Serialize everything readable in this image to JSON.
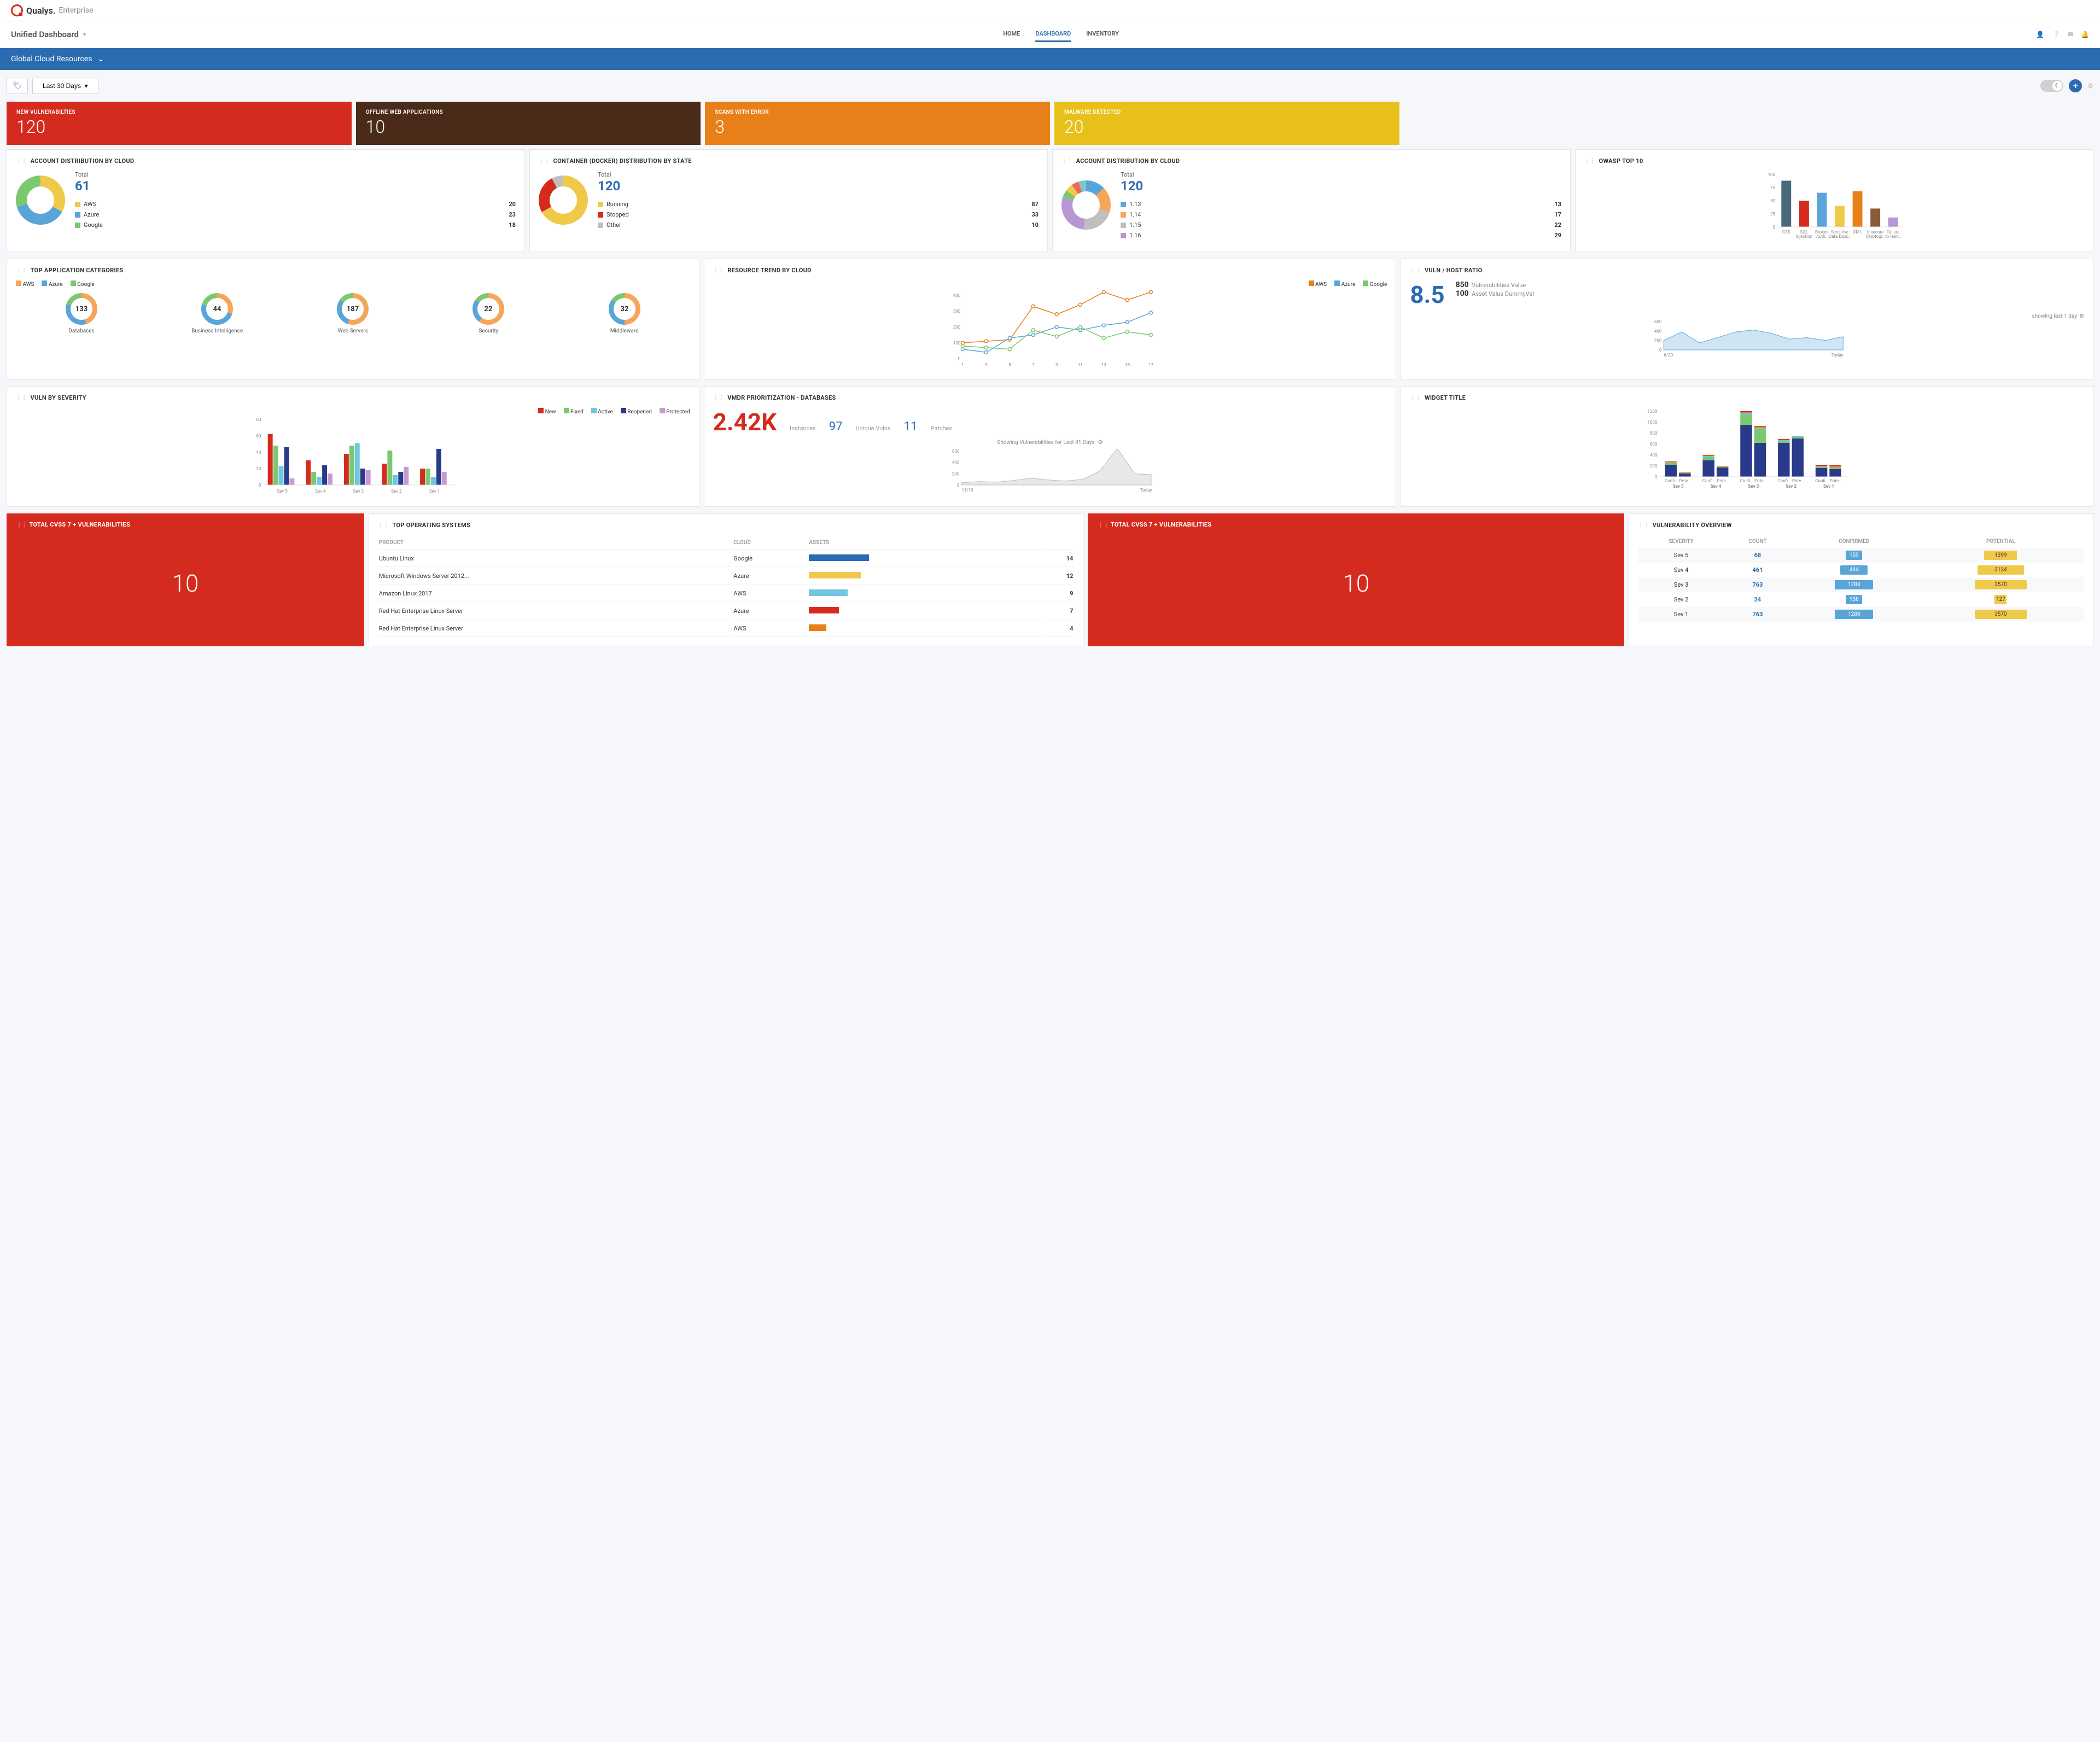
{
  "brand": {
    "name": "Qualys.",
    "suffix": "Enterprise"
  },
  "dashboard_title": "Unified Dashboard",
  "nav": {
    "items": [
      "HOME",
      "DASHBOARD",
      "INVENTORY"
    ],
    "active": 1
  },
  "blue_bar": "Global Cloud Resources",
  "date_range": "Last 30 Days",
  "stats": [
    {
      "label": "NEW VULNERABILTIES",
      "value": "120",
      "class": "stat-red"
    },
    {
      "label": "OFFLINE WEB APPLICATIONS",
      "value": "10",
      "class": "stat-brown"
    },
    {
      "label": "SCANS WITH ERROR",
      "value": "3",
      "class": "stat-orange"
    },
    {
      "label": "MALWARE DETECTED",
      "value": "20",
      "class": "stat-yellow"
    }
  ],
  "donut1": {
    "title": "ACCOUNT DISTRIBUTION BY CLOUD",
    "total_label": "Total",
    "total": "61",
    "items": [
      {
        "label": "AWS",
        "value": 20,
        "color": "#f0c94a"
      },
      {
        "label": "Azure",
        "value": 23,
        "color": "#5aa5d8"
      },
      {
        "label": "Google",
        "value": 18,
        "color": "#7bc96f"
      }
    ]
  },
  "donut2": {
    "title": "CONTAINER (DOCKER) DISTRIBUTION BY STATE",
    "total_label": "Total",
    "total": "120",
    "items": [
      {
        "label": "Running",
        "value": 87,
        "color": "#f0c94a"
      },
      {
        "label": "Stopped",
        "value": 33,
        "color": "#d52b1e"
      },
      {
        "label": "Other",
        "value": 10,
        "color": "#bfbfbf"
      }
    ]
  },
  "donut3": {
    "title": "ACCOUNT DISTRIBUTION BY CLOUD",
    "total_label": "Total",
    "total": "120",
    "items": [
      {
        "label": "1.13",
        "value": 13,
        "color": "#5aa5d8"
      },
      {
        "label": "1.14",
        "value": 17,
        "color": "#f5a65b"
      },
      {
        "label": "1.15",
        "value": 22,
        "color": "#bfbfbf"
      },
      {
        "label": "1.16",
        "value": 29,
        "color": "#b896d4"
      }
    ],
    "extra_colors": [
      "#7bc96f",
      "#f0c94a",
      "#e86a5a",
      "#7fc7c7"
    ]
  },
  "owasp": {
    "title": "OWASP TOP 10",
    "ymax": 100,
    "yticks": [
      0,
      25,
      50,
      75,
      100
    ],
    "bars": [
      {
        "label": "CSS",
        "value": 88,
        "color": "#4a6a7a"
      },
      {
        "label": "SQL Injection",
        "value": 50,
        "color": "#d52b1e"
      },
      {
        "label": "Broken Auth..",
        "value": 65,
        "color": "#5aa5d8"
      },
      {
        "label": "Sensitive Data Expo..",
        "value": 40,
        "color": "#f0c94a"
      },
      {
        "label": "XML",
        "value": 68,
        "color": "#e8801a"
      },
      {
        "label": "Insecure Cryptogr..",
        "value": 35,
        "color": "#8b5a3a"
      },
      {
        "label": "Failure to restr..",
        "value": 18,
        "color": "#b896d4"
      }
    ]
  },
  "top_app": {
    "title": "TOP APPLICATION CATEGORIES",
    "legend": [
      {
        "label": "AWS",
        "color": "#f5a65b"
      },
      {
        "label": "Azure",
        "color": "#5aa5d8"
      },
      {
        "label": "Google",
        "color": "#7bc96f"
      }
    ],
    "items": [
      {
        "label": "Databases",
        "value": 133,
        "seg": [
          45,
          35,
          20
        ]
      },
      {
        "label": "Business Intelligence",
        "value": 44,
        "seg": [
          30,
          50,
          20
        ]
      },
      {
        "label": "Web Servers",
        "value": 187,
        "seg": [
          55,
          30,
          15
        ]
      },
      {
        "label": "Security",
        "value": 22,
        "seg": [
          60,
          25,
          15
        ]
      },
      {
        "label": "Middleware",
        "value": 32,
        "seg": [
          50,
          35,
          15
        ]
      }
    ]
  },
  "resource_trend": {
    "title": "RESOURCE TREND BY CLOUD",
    "legend": [
      {
        "label": "AWS",
        "color": "#e8801a"
      },
      {
        "label": "Azure",
        "color": "#5aa5d8"
      },
      {
        "label": "Google",
        "color": "#7bc96f"
      }
    ],
    "x": [
      1,
      3,
      5,
      7,
      9,
      11,
      13,
      15,
      17
    ],
    "yticks": [
      0,
      100,
      200,
      300,
      400
    ],
    "series": {
      "AWS": [
        100,
        110,
        120,
        330,
        280,
        340,
        420,
        370,
        420
      ],
      "Azure": [
        60,
        40,
        130,
        150,
        200,
        180,
        210,
        230,
        290
      ],
      "Google": [
        80,
        70,
        60,
        180,
        140,
        200,
        130,
        170,
        150
      ]
    }
  },
  "vuln_ratio": {
    "title": "VULN / HOST RATIO",
    "big": "8.5",
    "side": [
      {
        "num": "850",
        "label": "Vulnerabilities Value"
      },
      {
        "num": "100",
        "label": "Asset Value   DummyVal"
      }
    ],
    "showing": "showing last 1 day",
    "area_y": [
      200,
      380,
      150,
      260,
      380,
      420,
      350,
      230,
      260,
      200,
      280
    ],
    "yticks": [
      0,
      200,
      400,
      600
    ],
    "xstart": "6/20",
    "xend": "Today"
  },
  "vuln_severity": {
    "title": "VULN BY SEVERITY",
    "legend": [
      {
        "label": "New",
        "color": "#d52b1e"
      },
      {
        "label": "Fixed",
        "color": "#7bc96f"
      },
      {
        "label": "Active",
        "color": "#6fc7e0"
      },
      {
        "label": "Reopened",
        "color": "#2a3a8a"
      },
      {
        "label": "Protected",
        "color": "#c89ad4"
      }
    ],
    "yticks": [
      0,
      20,
      40,
      60,
      80
    ],
    "groups": [
      "Sev 5",
      "Sev 4",
      "Sev 3",
      "Sev 2",
      "Sev 1"
    ],
    "data": {
      "Sev 5": [
        62,
        48,
        23,
        46,
        8
      ],
      "Sev 4": [
        30,
        16,
        10,
        24,
        14
      ],
      "Sev 3": [
        38,
        48,
        51,
        20,
        18
      ],
      "Sev 2": [
        26,
        42,
        12,
        16,
        22
      ],
      "Sev 1": [
        20,
        20,
        10,
        44,
        16
      ]
    }
  },
  "vmdr": {
    "title": "VMDR PRIORITIZATION - DATABASES",
    "big": "2.42K",
    "big_label": "Instances",
    "vulns": "97",
    "vulns_label": "Unique Vulns",
    "patches": "11",
    "patches_label": "Patches",
    "sub": "Showing Vulnerabilities for Last 91 Days",
    "area_y": [
      40,
      60,
      50,
      80,
      120,
      90,
      70,
      100,
      250,
      650,
      200,
      180
    ],
    "yticks": [
      0,
      200,
      400,
      600
    ],
    "xstart": "11/19",
    "xend": "Today"
  },
  "widget": {
    "title": "WIDGET TITLE",
    "yticks": [
      0,
      200,
      400,
      600,
      800,
      1000,
      1200
    ],
    "legend_colors": {
      "a": "#2a3a8a",
      "b": "#7bc96f",
      "c": "#6fc7e0",
      "d": "#e8801a",
      "e": "#d52b1e"
    },
    "groups": [
      "Sev 5",
      "Sev 4",
      "Sev 3",
      "Sev 2",
      "Sev 1"
    ],
    "pairs": [
      "Confi..",
      "Pote.."
    ],
    "data": {
      "Sev 5": {
        "Confi..": [
          220,
          30,
          10,
          10,
          10
        ],
        "Pote..": [
          60,
          10,
          0,
          10,
          0
        ]
      },
      "Sev 4": {
        "Confi..": [
          300,
          60,
          20,
          10,
          10
        ],
        "Pote..": [
          170,
          10,
          0,
          10,
          0
        ]
      },
      "Sev 3": {
        "Confi..": [
          950,
          180,
          30,
          20,
          20
        ],
        "Pote..": [
          620,
          260,
          20,
          20,
          10
        ]
      },
      "Sev 2": {
        "Confi..": [
          620,
          30,
          20,
          10,
          10
        ],
        "Pote..": [
          700,
          30,
          10,
          10,
          0
        ]
      },
      "Sev 1": {
        "Confi..": [
          160,
          20,
          10,
          10,
          20
        ],
        "Pote..": [
          140,
          20,
          10,
          30,
          10
        ]
      }
    }
  },
  "cvss": {
    "title": "TOTAL CVSS 7 + VULNERABILITIES",
    "value": "10"
  },
  "top_os": {
    "title": "TOP OPERATING SYSTEMS",
    "headers": [
      "PRODUCT",
      "CLOUD",
      "ASSETS"
    ],
    "rows": [
      {
        "product": "Ubuntu Linux",
        "cloud": "Google",
        "assets": 14,
        "color": "#2b6cb0"
      },
      {
        "product": "Microsoft Windows Server 2012...",
        "cloud": "Azure",
        "assets": 12,
        "color": "#f0c94a"
      },
      {
        "product": "Amazon Linux 2017",
        "cloud": "AWS",
        "assets": 9,
        "color": "#6fc7e0"
      },
      {
        "product": "Red Hat Enterprise Linux Server",
        "cloud": "Azure",
        "assets": 7,
        "color": "#d52b1e"
      },
      {
        "product": "Red Hat Enterprise Linux Server",
        "cloud": "AWS",
        "assets": 4,
        "color": "#e8801a"
      }
    ]
  },
  "vuln_overview": {
    "title": "VULNERABILITY OVERVIEW",
    "headers": [
      "SEVERITY",
      "COUNT",
      "CONFIRMED",
      "POTENTIAL"
    ],
    "rows": [
      {
        "sev": "Sev 5",
        "count": 68,
        "confirmed": 155,
        "cw": 30,
        "potential": 1399,
        "pw": 60
      },
      {
        "sev": "Sev 4",
        "count": 461,
        "confirmed": 444,
        "cw": 50,
        "potential": 3134,
        "pw": 85
      },
      {
        "sev": "Sev 3",
        "count": 763,
        "confirmed": 1288,
        "cw": 70,
        "potential": 3570,
        "pw": 95
      },
      {
        "sev": "Sev 2",
        "count": 24,
        "confirmed": 158,
        "cw": 30,
        "potential": 127,
        "pw": 22
      },
      {
        "sev": "Sev 1",
        "count": 763,
        "confirmed": 1288,
        "cw": 70,
        "potential": 3570,
        "pw": 95
      }
    ]
  },
  "chart_data": [
    {
      "type": "pie",
      "title": "ACCOUNT DISTRIBUTION BY CLOUD",
      "categories": [
        "AWS",
        "Azure",
        "Google"
      ],
      "values": [
        20,
        23,
        18
      ]
    },
    {
      "type": "pie",
      "title": "CONTAINER (DOCKER) DISTRIBUTION BY STATE",
      "categories": [
        "Running",
        "Stopped",
        "Other"
      ],
      "values": [
        87,
        33,
        10
      ]
    },
    {
      "type": "pie",
      "title": "ACCOUNT DISTRIBUTION BY CLOUD",
      "categories": [
        "1.13",
        "1.14",
        "1.15",
        "1.16"
      ],
      "values": [
        13,
        17,
        22,
        29
      ]
    },
    {
      "type": "bar",
      "title": "OWASP TOP 10",
      "categories": [
        "CSS",
        "SQL Injection",
        "Broken Auth..",
        "Sensitive Data Expo..",
        "XML",
        "Insecure Cryptogr..",
        "Failure to restr.."
      ],
      "values": [
        88,
        50,
        65,
        40,
        68,
        35,
        18
      ],
      "ylim": [
        0,
        100
      ]
    },
    {
      "type": "line",
      "title": "RESOURCE TREND BY CLOUD",
      "x": [
        1,
        3,
        5,
        7,
        9,
        11,
        13,
        15,
        17
      ],
      "series": [
        {
          "name": "AWS",
          "values": [
            100,
            110,
            120,
            330,
            280,
            340,
            420,
            370,
            420
          ]
        },
        {
          "name": "Azure",
          "values": [
            60,
            40,
            130,
            150,
            200,
            180,
            210,
            230,
            290
          ]
        },
        {
          "name": "Google",
          "values": [
            80,
            70,
            60,
            180,
            140,
            200,
            130,
            170,
            150
          ]
        }
      ],
      "ylim": [
        0,
        400
      ]
    },
    {
      "type": "area",
      "title": "VULN / HOST RATIO",
      "values": [
        200,
        380,
        150,
        260,
        380,
        420,
        350,
        230,
        260,
        200,
        280
      ],
      "ylim": [
        0,
        600
      ]
    },
    {
      "type": "bar",
      "title": "VULN BY SEVERITY",
      "categories": [
        "Sev 5",
        "Sev 4",
        "Sev 3",
        "Sev 2",
        "Sev 1"
      ],
      "series": [
        {
          "name": "New",
          "values": [
            62,
            30,
            38,
            26,
            20
          ]
        },
        {
          "name": "Fixed",
          "values": [
            48,
            16,
            48,
            42,
            20
          ]
        },
        {
          "name": "Active",
          "values": [
            23,
            10,
            51,
            12,
            10
          ]
        },
        {
          "name": "Reopened",
          "values": [
            46,
            24,
            20,
            16,
            44
          ]
        },
        {
          "name": "Protected",
          "values": [
            8,
            14,
            18,
            22,
            16
          ]
        }
      ],
      "ylim": [
        0,
        80
      ]
    },
    {
      "type": "area",
      "title": "VMDR PRIORITIZATION - DATABASES",
      "values": [
        40,
        60,
        50,
        80,
        120,
        90,
        70,
        100,
        250,
        650,
        200,
        180
      ],
      "ylim": [
        0,
        600
      ]
    },
    {
      "type": "bar",
      "title": "WIDGET TITLE",
      "categories": [
        "Sev 5 Confi..",
        "Sev 5 Pote..",
        "Sev 4 Confi..",
        "Sev 4 Pote..",
        "Sev 3 Confi..",
        "Sev 3 Pote..",
        "Sev 2 Confi..",
        "Sev 2 Pote..",
        "Sev 1 Confi..",
        "Sev 1 Pote.."
      ],
      "values": [
        280,
        80,
        400,
        190,
        1200,
        930,
        690,
        750,
        220,
        210
      ],
      "ylim": [
        0,
        1200
      ]
    },
    {
      "type": "bar",
      "title": "TOP OPERATING SYSTEMS",
      "categories": [
        "Ubuntu Linux",
        "Microsoft Windows Server 2012...",
        "Amazon Linux 2017",
        "Red Hat Enterprise Linux Server (Azure)",
        "Red Hat Enterprise Linux Server (AWS)"
      ],
      "values": [
        14,
        12,
        9,
        7,
        4
      ]
    },
    {
      "type": "table",
      "title": "VULNERABILITY OVERVIEW",
      "columns": [
        "SEVERITY",
        "COUNT",
        "CONFIRMED",
        "POTENTIAL"
      ],
      "rows": [
        [
          "Sev 5",
          68,
          155,
          1399
        ],
        [
          "Sev 4",
          461,
          444,
          3134
        ],
        [
          "Sev 3",
          763,
          1288,
          3570
        ],
        [
          "Sev 2",
          24,
          158,
          127
        ],
        [
          "Sev 1",
          763,
          1288,
          3570
        ]
      ]
    }
  ]
}
